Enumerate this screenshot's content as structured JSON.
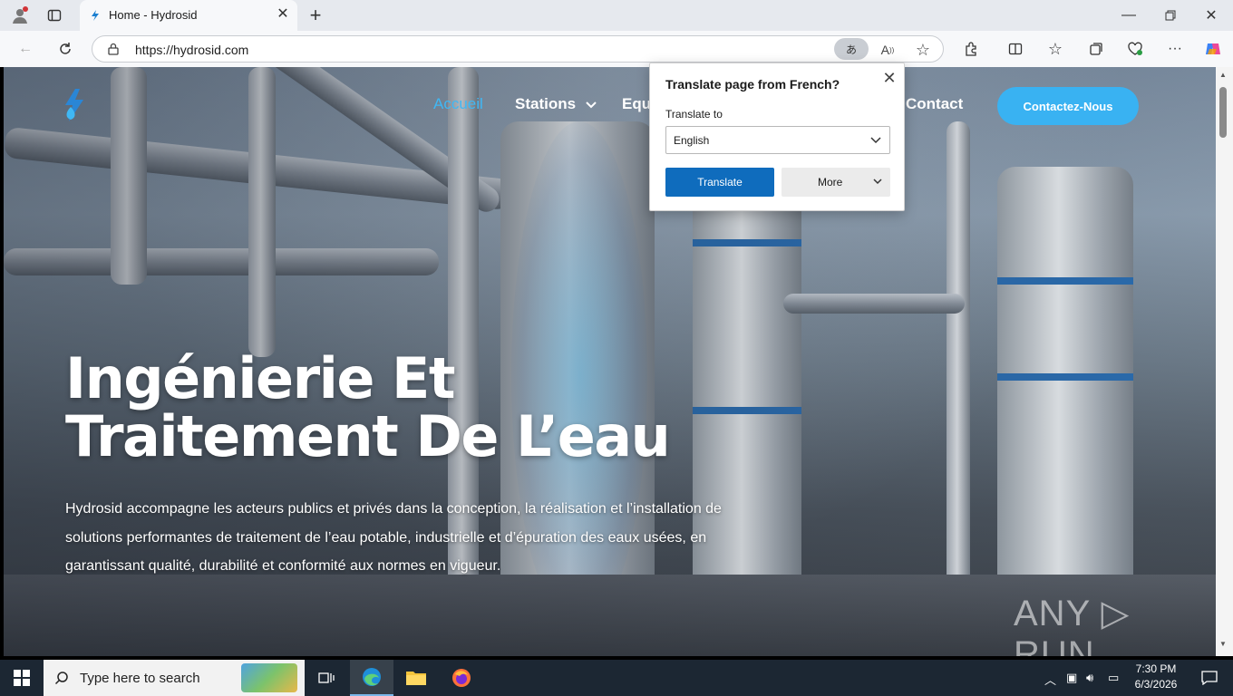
{
  "browser": {
    "tab_title": "Home - Hydrosid",
    "url": "https://hydrosid.com",
    "translate_icon_text": "あ"
  },
  "site": {
    "nav": {
      "home": "Accueil",
      "stations": "Stations",
      "equipment": "Equ",
      "contact": "Contact",
      "contact_button": "Contactez-Nous"
    },
    "hero_title": "Ingénierie Et Traitement De L’eau",
    "hero_text": "Hydrosid accompagne les acteurs publics et privés dans la conception, la réalisation et l’installation de solutions performantes de traitement de l’eau potable, industrielle et d’épuration des eaux usées, en garantissant qualité, durabilité et conformité aux normes en vigueur.",
    "accent_color": "#39b2f2"
  },
  "translate_popup": {
    "title": "Translate page from French?",
    "label": "Translate to",
    "selected_language": "English",
    "translate_button": "Translate",
    "more_button": "More"
  },
  "watermark": "ANY ▷ RUN",
  "taskbar": {
    "search_placeholder": "Type here to search",
    "time": "7:30 PM",
    "date": "6/3/2026"
  }
}
